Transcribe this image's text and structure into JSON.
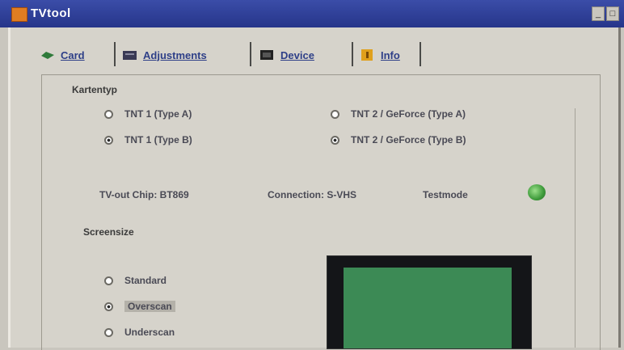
{
  "window": {
    "title": "TVtool",
    "controls": [
      "_",
      "□"
    ]
  },
  "tabs": [
    {
      "label": "Card",
      "icon": "card-icon"
    },
    {
      "label": "Adjustments",
      "icon": "adjustments-icon"
    },
    {
      "label": "Device",
      "icon": "device-icon"
    },
    {
      "label": "Info",
      "icon": "info-icon"
    }
  ],
  "card": {
    "section_cardtype": "Kartentyp",
    "options_left": [
      {
        "label": "TNT 1 (Type A)",
        "selected": false
      },
      {
        "label": "TNT 1 (Type B)",
        "selected": true
      }
    ],
    "options_right": [
      {
        "label": "TNT 2 / GeForce (Type A)",
        "selected": false
      },
      {
        "label": "TNT 2 / GeForce (Type B)",
        "selected": true
      }
    ],
    "tvout_chip": "TV-out Chip: BT869",
    "connection": "Connection: S-VHS",
    "test_mode": "Testmode",
    "section_screen": "Screensize",
    "screen_options": [
      {
        "label": "Standard",
        "selected": false
      },
      {
        "label": "Overscan",
        "selected": true
      },
      {
        "label": "Underscan",
        "selected": false
      }
    ]
  },
  "colors": {
    "title_bar": "#26358a",
    "window_bg": "#d6d3cb",
    "led": "#3d9a3a",
    "preview_screen": "#3c8a55"
  }
}
